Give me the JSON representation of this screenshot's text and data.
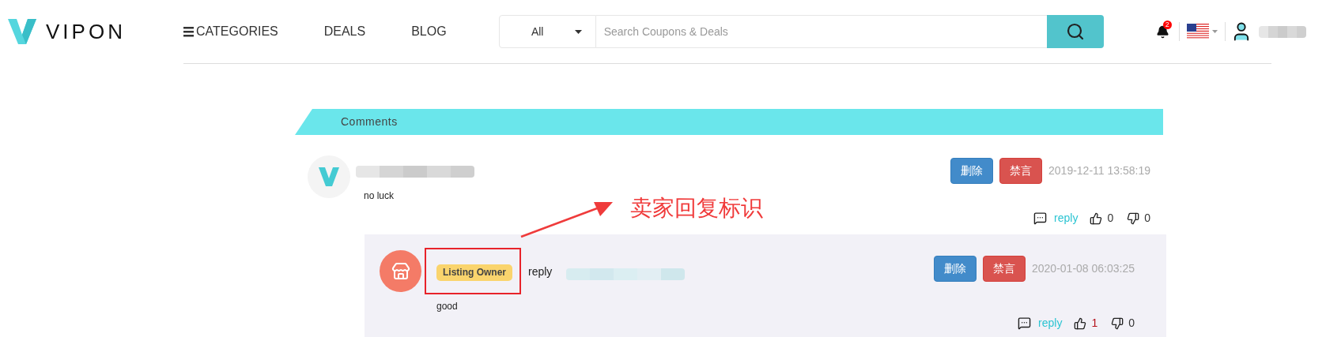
{
  "logo": {
    "text": "VIPON"
  },
  "nav": [
    {
      "label": "CATEGORIES",
      "kind": "menu"
    },
    {
      "label": "DEALS",
      "kind": "link"
    },
    {
      "label": "BLOG",
      "kind": "link"
    }
  ],
  "search": {
    "category": "All",
    "placeholder": "Search Coupons & Deals"
  },
  "notifications": {
    "count": "2"
  },
  "section": {
    "title": "Comments"
  },
  "comments": [
    {
      "avatar": {
        "kind": "logo"
      },
      "text": "no luck",
      "buttons": [
        {
          "label": "删除",
          "kind": "delete"
        },
        {
          "label": "禁言",
          "kind": "ban"
        }
      ],
      "date": "2019-12-11 13:58:19",
      "reply_label": "reply",
      "likes": "0",
      "liked": false,
      "dislikes": "0",
      "replies": [
        {
          "avatar": {
            "kind": "store"
          },
          "badge": "Listing Owner",
          "verb": "reply",
          "text": "good",
          "buttons": [
            {
              "label": "删除",
              "kind": "delete"
            },
            {
              "label": "禁言",
              "kind": "ban"
            }
          ],
          "date": "2020-01-08 06:03:25",
          "reply_label": "reply",
          "likes": "1",
          "liked": true,
          "dislikes": "0"
        }
      ]
    }
  ],
  "annotation": {
    "text": "卖家回复标识"
  }
}
